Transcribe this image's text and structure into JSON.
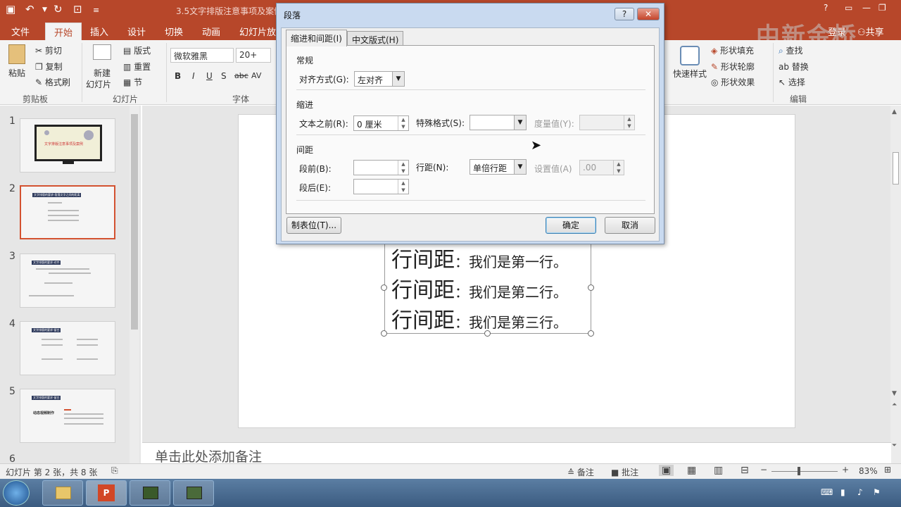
{
  "titlebar": {
    "title": "3.5文字排版注意事项及案例",
    "help": "?"
  },
  "tabs": [
    "文件",
    "开始",
    "插入",
    "设计",
    "切换",
    "动画",
    "幻灯片放映"
  ],
  "account": {
    "login": "登录",
    "share": "共享"
  },
  "watermark": "中新金桥",
  "ribbon": {
    "clipboard": {
      "paste": "粘贴",
      "cut": "剪切",
      "copy": "复制",
      "format_painter": "格式刷",
      "group": "剪贴板"
    },
    "slides": {
      "new_slide": "新建",
      "new_slide2": "幻灯片",
      "layout": "版式",
      "reset": "重置",
      "section": "节",
      "group": "幻灯片"
    },
    "font": {
      "name": "微软雅黑",
      "size": "20+",
      "group": "字体",
      "bold": "B",
      "italic": "I",
      "underline": "U",
      "shadow": "S",
      "strike": "abc",
      "spacing": "AV"
    },
    "drawing": {
      "quick_styles": "快速样式",
      "shape_fill": "形状填充",
      "shape_outline": "形状轮廓",
      "shape_effects": "形状效果"
    },
    "editing": {
      "find": "查找",
      "replace": "替换",
      "select": "选择",
      "group": "编辑"
    }
  },
  "thumbnails": {
    "numbers": [
      "1",
      "2",
      "3",
      "4",
      "5",
      "6"
    ],
    "slide1_title": "文字排版注意事项及案例",
    "slide2_header": "文字排版的要求-段落文字之间的距离",
    "slide3_header": "文字排版的要求-对齐",
    "slide4_header": "文字排版的要求-留白",
    "slide5_header": "文字排版的要求-留白",
    "slide5_body": "动态视频制作"
  },
  "slide_text": {
    "lines": [
      {
        "head": "行间距",
        "body": "：我们是第一行。"
      },
      {
        "head": "行间距",
        "body": "：我们是第二行。"
      },
      {
        "head": "行间距",
        "body": "：我们是第三行。"
      }
    ]
  },
  "notes_placeholder": "单击此处添加备注",
  "status": {
    "slide_info": "幻灯片 第 2 张，共 8 张",
    "notes": "备注",
    "comments": "批注",
    "zoom": "83%"
  },
  "dialog": {
    "title": "段落",
    "tab_indent": "缩进和间距(I)",
    "tab_chinese": "中文版式(H)",
    "general": "常规",
    "alignment_label": "对齐方式(G):",
    "alignment_value": "左对齐",
    "indent": "缩进",
    "before_text_label": "文本之前(R):",
    "before_text_value": "0 厘米",
    "special_label": "特殊格式(S):",
    "measure_label": "度量值(Y):",
    "spacing": "间距",
    "before_label": "段前(B):",
    "after_label": "段后(E):",
    "line_spacing_label": "行距(N):",
    "line_spacing_value": "单倍行距",
    "set_value_label": "设置值(A)",
    "set_value": ".00",
    "tabs_button": "制表位(T)...",
    "ok": "确定",
    "cancel": "取消"
  }
}
